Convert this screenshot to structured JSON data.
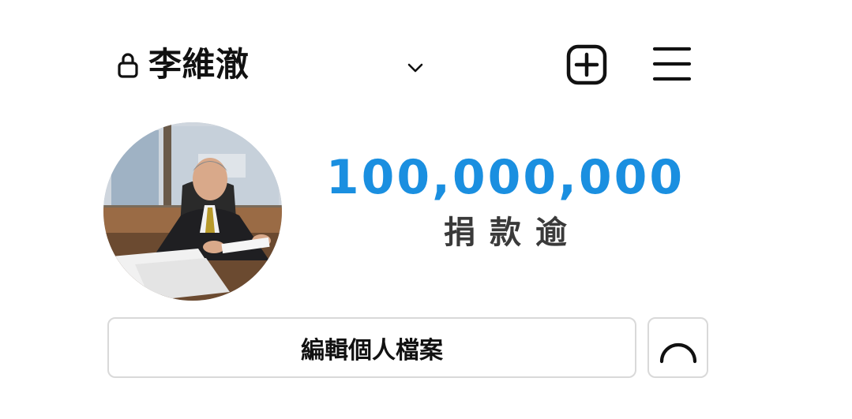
{
  "header": {
    "username": "李維澈",
    "lock_icon": "lock-icon",
    "switch_icon": "chevron-down-icon",
    "new_post_icon": "plus-square-icon",
    "menu_icon": "hamburger-menu-icon"
  },
  "profile": {
    "avatar_icon": "profile-photo",
    "stat_value": "100,000,000",
    "stat_label": "捐款逾",
    "stat_color": "#1a8fe0"
  },
  "actions": {
    "edit_profile_label": "編輯個人檔案",
    "suggest_icon": "loading-spinner-icon"
  }
}
